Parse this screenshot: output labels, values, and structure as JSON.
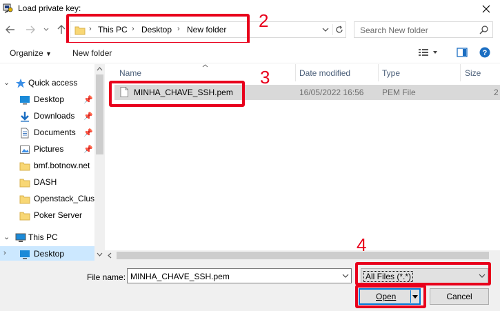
{
  "window": {
    "title": "Load private key:"
  },
  "address": {
    "crumbs": [
      "This PC",
      "Desktop",
      "New folder"
    ],
    "search_placeholder": "Search New folder"
  },
  "annotations": {
    "n2": "2",
    "n3": "3",
    "n4": "4"
  },
  "toolbar": {
    "organize": "Organize",
    "new_folder": "New folder"
  },
  "nav": {
    "quick_access": "Quick access",
    "items": [
      {
        "label": "Desktop",
        "icon": "desktop-icon",
        "pinned": true
      },
      {
        "label": "Downloads",
        "icon": "download-arrow-icon",
        "pinned": true
      },
      {
        "label": "Documents",
        "icon": "document-icon",
        "pinned": true
      },
      {
        "label": "Pictures",
        "icon": "pictures-icon",
        "pinned": true
      },
      {
        "label": "bmf.botnow.net",
        "icon": "folder-icon",
        "pinned": false
      },
      {
        "label": "DASH",
        "icon": "folder-icon",
        "pinned": false
      },
      {
        "label": "Openstack_Clust",
        "icon": "folder-icon",
        "pinned": false
      },
      {
        "label": "Poker Server",
        "icon": "folder-icon",
        "pinned": false
      }
    ],
    "this_pc": "This PC",
    "this_pc_desktop": "Desktop"
  },
  "columns": {
    "name": "Name",
    "date": "Date modified",
    "type": "Type",
    "size": "Size"
  },
  "files": [
    {
      "name": "MINHA_CHAVE_SSH.pem",
      "date": "16/05/2022 16:56",
      "type": "PEM File",
      "size": "2"
    }
  ],
  "bottom": {
    "file_name_label": "File name:",
    "file_name_value": "MINHA_CHAVE_SSH.pem",
    "filter": "All Files (*.*)",
    "open": "Open",
    "cancel": "Cancel"
  },
  "colors": {
    "highlight": "#e8001c",
    "selection": "#cce8ff",
    "accent": "#0078d7"
  }
}
